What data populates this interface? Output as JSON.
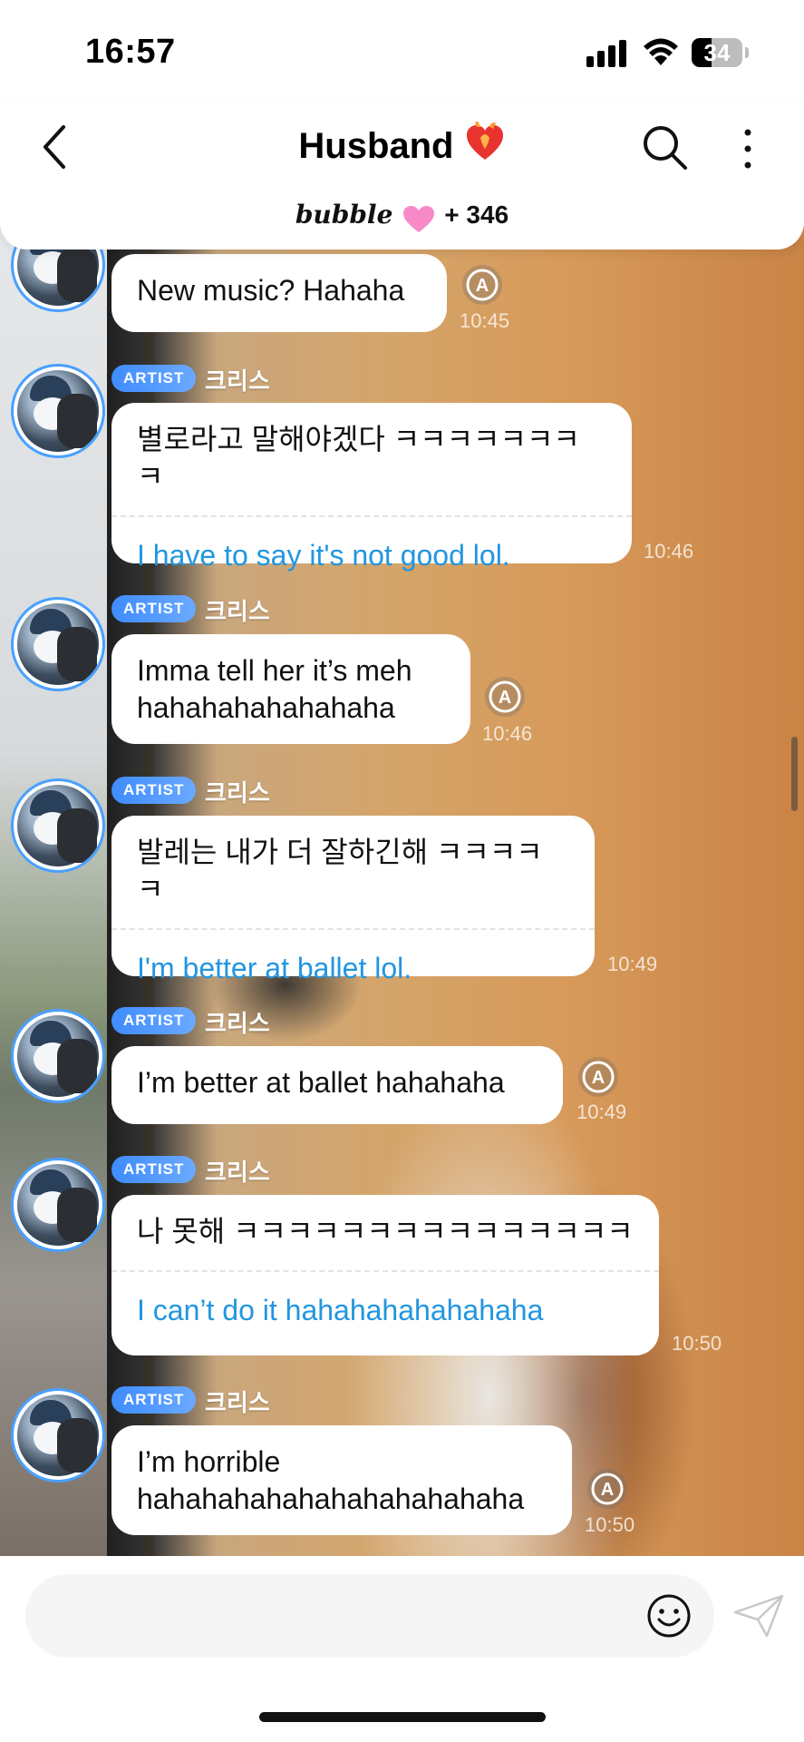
{
  "status": {
    "time": "16:57",
    "battery": "34"
  },
  "header": {
    "title": "Husband",
    "brand": "bubble",
    "count": "+ 346"
  },
  "colors": {
    "accent_blue": "#2196e0",
    "badge": "#4a94ff",
    "avatar_ring": "#4aa0ff"
  },
  "messages": [
    {
      "text": "New music? Hahaha",
      "time": "10:45",
      "icon": "translate-icon"
    },
    {
      "badge": "ARTIST",
      "sender": "크리스",
      "text": "별로라고 말해야겠다 ㅋㅋㅋㅋㅋㅋㅋㅋ",
      "translation": "I have to say it's not good lol.",
      "time": "10:46"
    },
    {
      "badge": "ARTIST",
      "sender": "크리스",
      "text_lines": [
        "Imma tell her it’s meh",
        "hahahahahahahaha"
      ],
      "time": "10:46",
      "icon": "translate-icon"
    },
    {
      "badge": "ARTIST",
      "sender": "크리스",
      "text": "발레는 내가 더 잘하긴해 ㅋㅋㅋㅋㅋ",
      "translation": "I'm better at ballet lol.",
      "time": "10:49"
    },
    {
      "badge": "ARTIST",
      "sender": "크리스",
      "text": "I’m better at ballet hahahaha",
      "time": "10:49",
      "icon": "translate-icon"
    },
    {
      "badge": "ARTIST",
      "sender": "크리스",
      "text": "나 못해 ㅋㅋㅋㅋㅋㅋㅋㅋㅋㅋㅋㅋㅋㅋㅋ",
      "translation": "I can’t do it hahahahahahahaha",
      "time": "10:50"
    },
    {
      "badge": "ARTIST",
      "sender": "크리스",
      "text_lines": [
        "I’m horrible",
        "hahahahahahahahahahahaha"
      ],
      "time": "10:50",
      "icon": "translate-icon"
    }
  ],
  "input": {
    "placeholder": ""
  }
}
